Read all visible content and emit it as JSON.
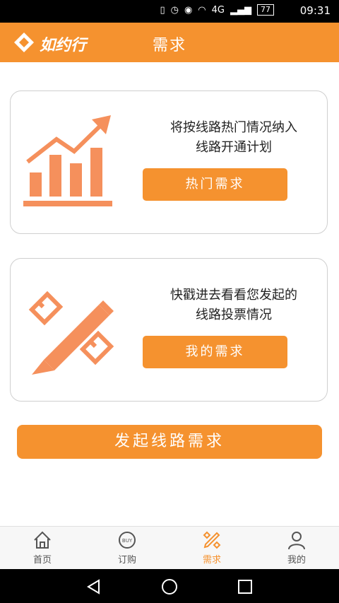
{
  "status_bar": {
    "time": "09:31",
    "battery": "77",
    "network": "4G"
  },
  "header": {
    "app_name": "如约行",
    "title": "需求"
  },
  "cards": [
    {
      "text_line1": "将按线路热门情况纳入",
      "text_line2": "线路开通计划",
      "button_label": "热门需求",
      "icon": "rising-chart-icon"
    },
    {
      "text_line1": "快戳进去看看您发起的",
      "text_line2": "线路投票情况",
      "button_label": "我的需求",
      "icon": "pencil-ruler-icon"
    }
  ],
  "cta": {
    "label": "发起线路需求"
  },
  "tabs": [
    {
      "label": "首页",
      "icon": "home-icon",
      "active": false
    },
    {
      "label": "订购",
      "icon": "buy-icon",
      "icon_text": "BUY",
      "active": false
    },
    {
      "label": "需求",
      "icon": "pencil-ruler-icon",
      "active": true
    },
    {
      "label": "我的",
      "icon": "user-icon",
      "active": false
    }
  ],
  "colors": {
    "accent": "#f5922f",
    "illustration": "#f5905c"
  }
}
